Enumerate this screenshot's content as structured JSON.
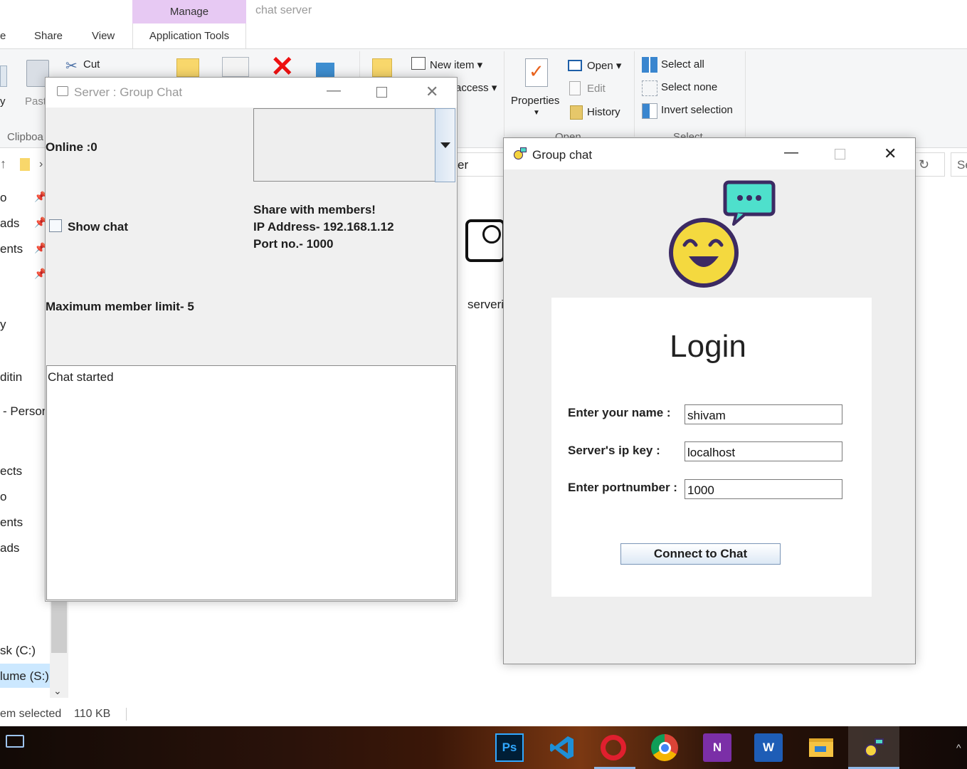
{
  "explorer": {
    "context_tab": "Manage",
    "window_title": "chat server",
    "tabs": {
      "partial_file": "e",
      "share": "Share",
      "view": "View",
      "app_tools": "Application Tools"
    },
    "clipboard": {
      "partial_copy": "y",
      "paste": "Past",
      "cut": "Cut",
      "group_label": "Clipboa"
    },
    "new": {
      "new_item": "New item",
      "easy_access": "access"
    },
    "open": {
      "properties": "Properties",
      "open": "Open",
      "edit": "Edit",
      "history": "History",
      "group_label": "Open"
    },
    "select": {
      "select_all": "Select all",
      "select_none": "Select none",
      "invert": "Invert selection",
      "group_label": "Select"
    },
    "address_partial": "er",
    "search_partial": "Se",
    "file_name_partial": "serveri",
    "nav_items": [
      "o",
      "ads",
      "ents",
      "",
      "y",
      "ditin",
      "- Person",
      "ects",
      "o",
      "ents",
      "ads",
      "sk (C:)",
      "lume (S:)"
    ],
    "status": {
      "selected": "em selected",
      "size": "110 KB"
    }
  },
  "server_window": {
    "title": "Server : Group Chat",
    "online": "Online :0",
    "show_chat": "Show chat",
    "share_heading": "Share with members!",
    "ip_line": "IP Address- 192.168.1.12",
    "port_line": "Port no.- 1000",
    "member_limit": "Maximum member limit- 5",
    "chat_log": "Chat started"
  },
  "login_window": {
    "title": "Group chat",
    "heading": "Login",
    "name_label": "Enter your name :",
    "name_value": "shivam",
    "ip_label": "Server's ip key  :",
    "ip_value": "localhost",
    "port_label": "Enter portnumber :",
    "port_value": "1000",
    "connect_label": "Connect to Chat"
  },
  "taskbar": {
    "apps": [
      "photoshop-icon",
      "vscode-icon",
      "opera-icon",
      "chrome-icon",
      "onenote-icon",
      "word-icon",
      "file-explorer-icon",
      "group-chat-icon"
    ],
    "ps_text": "Ps",
    "onenote_text": "N",
    "word_text": "W"
  },
  "colors": {
    "manage_tab": "#e7c9f3",
    "accent_blue": "#0078d7",
    "close_red": "#e81123"
  }
}
